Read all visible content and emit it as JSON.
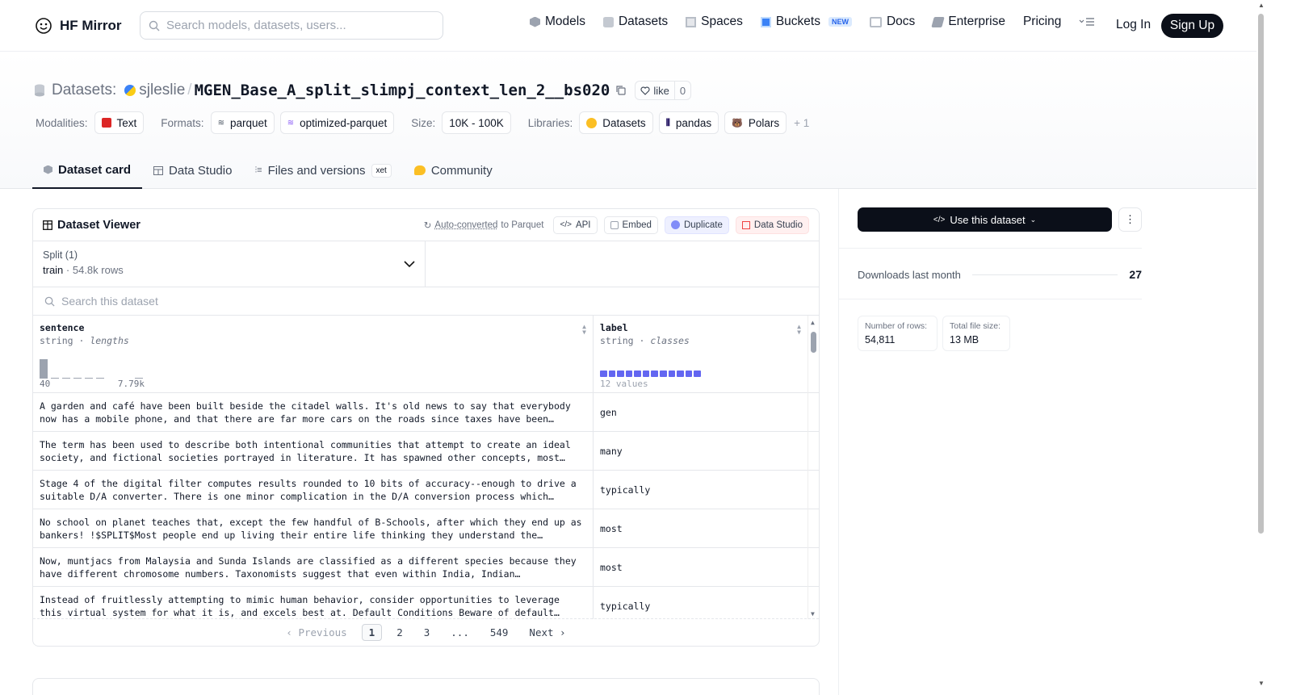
{
  "nav": {
    "brand": "HF Mirror",
    "search_placeholder": "Search models, datasets, users...",
    "links": [
      {
        "label": "Models",
        "icon": "models-icon",
        "color": "#6b7280"
      },
      {
        "label": "Datasets",
        "icon": "datasets-icon",
        "color": "#9ca3af"
      },
      {
        "label": "Spaces",
        "icon": "spaces-icon",
        "color": "#9ca3af"
      },
      {
        "label": "Buckets",
        "icon": "buckets-icon",
        "color": "#3b82f6",
        "badge": "NEW"
      },
      {
        "label": "Docs",
        "icon": "docs-icon",
        "color": "#9ca3af"
      },
      {
        "label": "Enterprise",
        "icon": "enterprise-icon",
        "color": "#6b7280"
      },
      {
        "label": "Pricing"
      }
    ],
    "login": "Log In",
    "signup": "Sign Up"
  },
  "header": {
    "section": "Datasets:",
    "owner": "sjleslie",
    "sep": "/",
    "name": "MGEN_Base_A_split_slimpj_context_len_2__bs020",
    "like_label": "like",
    "like_count": "0",
    "modalities_label": "Modalities:",
    "modality": "Text",
    "formats_label": "Formats:",
    "formats": [
      "parquet",
      "optimized-parquet"
    ],
    "size_label": "Size:",
    "size": "10K - 100K",
    "libraries_label": "Libraries:",
    "libraries": [
      "Datasets",
      "pandas",
      "Polars"
    ],
    "libraries_more": "+ 1"
  },
  "tabs": [
    {
      "label": "Dataset card",
      "icon": "dataset-card-icon"
    },
    {
      "label": "Data Studio",
      "icon": "table-icon"
    },
    {
      "label": "Files and versions",
      "icon": "files-icon",
      "badge": "xet"
    },
    {
      "label": "Community",
      "icon": "community-icon"
    }
  ],
  "viewer": {
    "title": "Dataset Viewer",
    "auto_prefix": "Auto-converted",
    "auto_suffix": "to Parquet",
    "api": "API",
    "embed": "Embed",
    "duplicate": "Duplicate",
    "data_studio": "Data Studio",
    "split_title": "Split (1)",
    "split_name": "train",
    "split_rows": "54.8k rows",
    "search_placeholder": "Search this dataset",
    "columns": [
      {
        "name": "sentence",
        "type": "string",
        "stat": "lengths",
        "min": "40",
        "max": "7.79k"
      },
      {
        "name": "label",
        "type": "string",
        "stat": "classes",
        "summary": "12 values"
      }
    ],
    "rows": [
      {
        "sentence": "A garden and café have been built beside the citadel walls. It's old news to say that everybody now has a mobile phone, and that there are far more cars on the roads since taxes have been…",
        "label": "gen"
      },
      {
        "sentence": "The term has been used to describe both intentional communities that attempt to create an ideal society, and fictional societies portrayed in literature. It has spawned other concepts, most…",
        "label": "many"
      },
      {
        "sentence": "Stage 4 of the digital filter computes results rounded to 10 bits of accuracy--enough to drive a suitable D/A converter. There is one minor complication in the D/A conversion process which…",
        "label": "typically"
      },
      {
        "sentence": "No school on planet teaches that, except the few handful of B-Schools, after which they end up as bankers! !$SPLIT$Most people end up living their entire life thinking they understand the…",
        "label": "most"
      },
      {
        "sentence": "Now, muntjacs from Malaysia and Sunda Islands are classified as a different species because they have different chromosome numbers. Taxonomists suggest that even within India, Indian…",
        "label": "most"
      },
      {
        "sentence": "Instead of fruitlessly attempting to mimic human behavior, consider opportunities to leverage this virtual system for what it is, and excels best at. Default Conditions Beware of default…",
        "label": "typically"
      }
    ],
    "pager": {
      "prev": "Previous",
      "pages": [
        "1",
        "2",
        "3",
        "...",
        "549"
      ],
      "next": "Next",
      "current": "1"
    }
  },
  "sidebar": {
    "use_button": "Use this dataset",
    "downloads_label": "Downloads last month",
    "downloads": "27",
    "rows_label": "Number of rows:",
    "rows": "54,811",
    "size_label": "Total file size:",
    "size": "13 MB"
  }
}
